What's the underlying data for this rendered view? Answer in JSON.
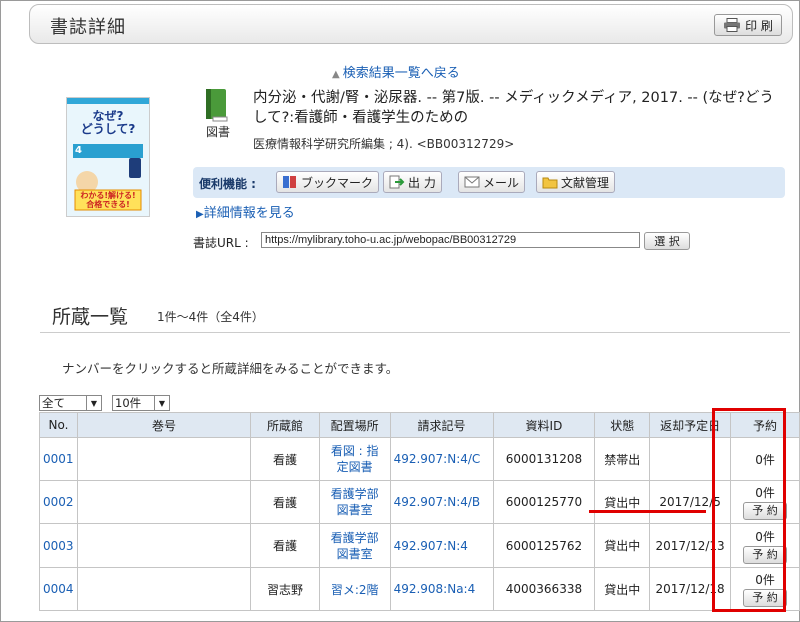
{
  "header": {
    "title": "書誌詳細",
    "print_label": "印 刷"
  },
  "back_link": "検索結果一覧へ戻る",
  "book": {
    "type_label": "図書",
    "title": "内分泌・代謝/腎・泌尿器. -- 第7版. -- メディックメディア, 2017. -- (なぜ?どうして?:看護師・看護学生のための",
    "subtitle": "医療情報科学研究所編集 ; 4). <BB00312729>",
    "cover_text": {
      "line1": "なぜ?",
      "line2": "どうして?",
      "num": "4",
      "tagline": "わかる!解ける!",
      "tagline2": "合格できる!"
    }
  },
  "functions": {
    "label": "便利機能 :",
    "bookmark": "ブックマーク",
    "output": "出 力",
    "mail": "メール",
    "docmgmt": "文献管理"
  },
  "detail_link": "詳細情報を見る",
  "url": {
    "label": "書誌URL :",
    "value": "https://mylibrary.toho-u.ac.jp/webopac/BB00312729",
    "select_label": "選 択"
  },
  "holdings": {
    "title": "所蔵一覧",
    "count": "1件～4件（全4件）",
    "hint": "ナンバーをクリックすると所蔵詳細をみることができます。",
    "filter_all": "全て",
    "per_page": "10件",
    "columns": [
      "No.",
      "巻号",
      "所蔵館",
      "配置場所",
      "請求記号",
      "資料ID",
      "状態",
      "返却予定日",
      "予約"
    ],
    "rows": [
      {
        "no": "0001",
        "vol": "",
        "lib": "看護",
        "loc1": "看図 : 指",
        "loc2": "定図書",
        "call": "492.907:N:4/C",
        "id": "6000131208",
        "status": "禁帯出",
        "due": "",
        "resv": "0件",
        "resv_btn": ""
      },
      {
        "no": "0002",
        "vol": "",
        "lib": "看護",
        "loc1": "看護学部",
        "loc2": "図書室",
        "call": "492.907:N:4/B",
        "id": "6000125770",
        "status": "貸出中",
        "due": "2017/12/5",
        "resv": "0件",
        "resv_btn": "予 約"
      },
      {
        "no": "0003",
        "vol": "",
        "lib": "看護",
        "loc1": "看護学部",
        "loc2": "図書室",
        "call": "492.907:N:4",
        "id": "6000125762",
        "status": "貸出中",
        "due": "2017/12/13",
        "resv": "0件",
        "resv_btn": "予 約"
      },
      {
        "no": "0004",
        "vol": "",
        "lib": "習志野",
        "loc1": "習メ:2階",
        "loc2": "",
        "call": "492.908:Na:4",
        "id": "4000366338",
        "status": "貸出中",
        "due": "2017/12/18",
        "resv": "0件",
        "resv_btn": "予 約"
      }
    ]
  },
  "colors": {
    "link": "#1a5fb4",
    "highlight": "#e00000",
    "func_bar": "#dbe8f6",
    "table_header": "#dfe8f2"
  }
}
